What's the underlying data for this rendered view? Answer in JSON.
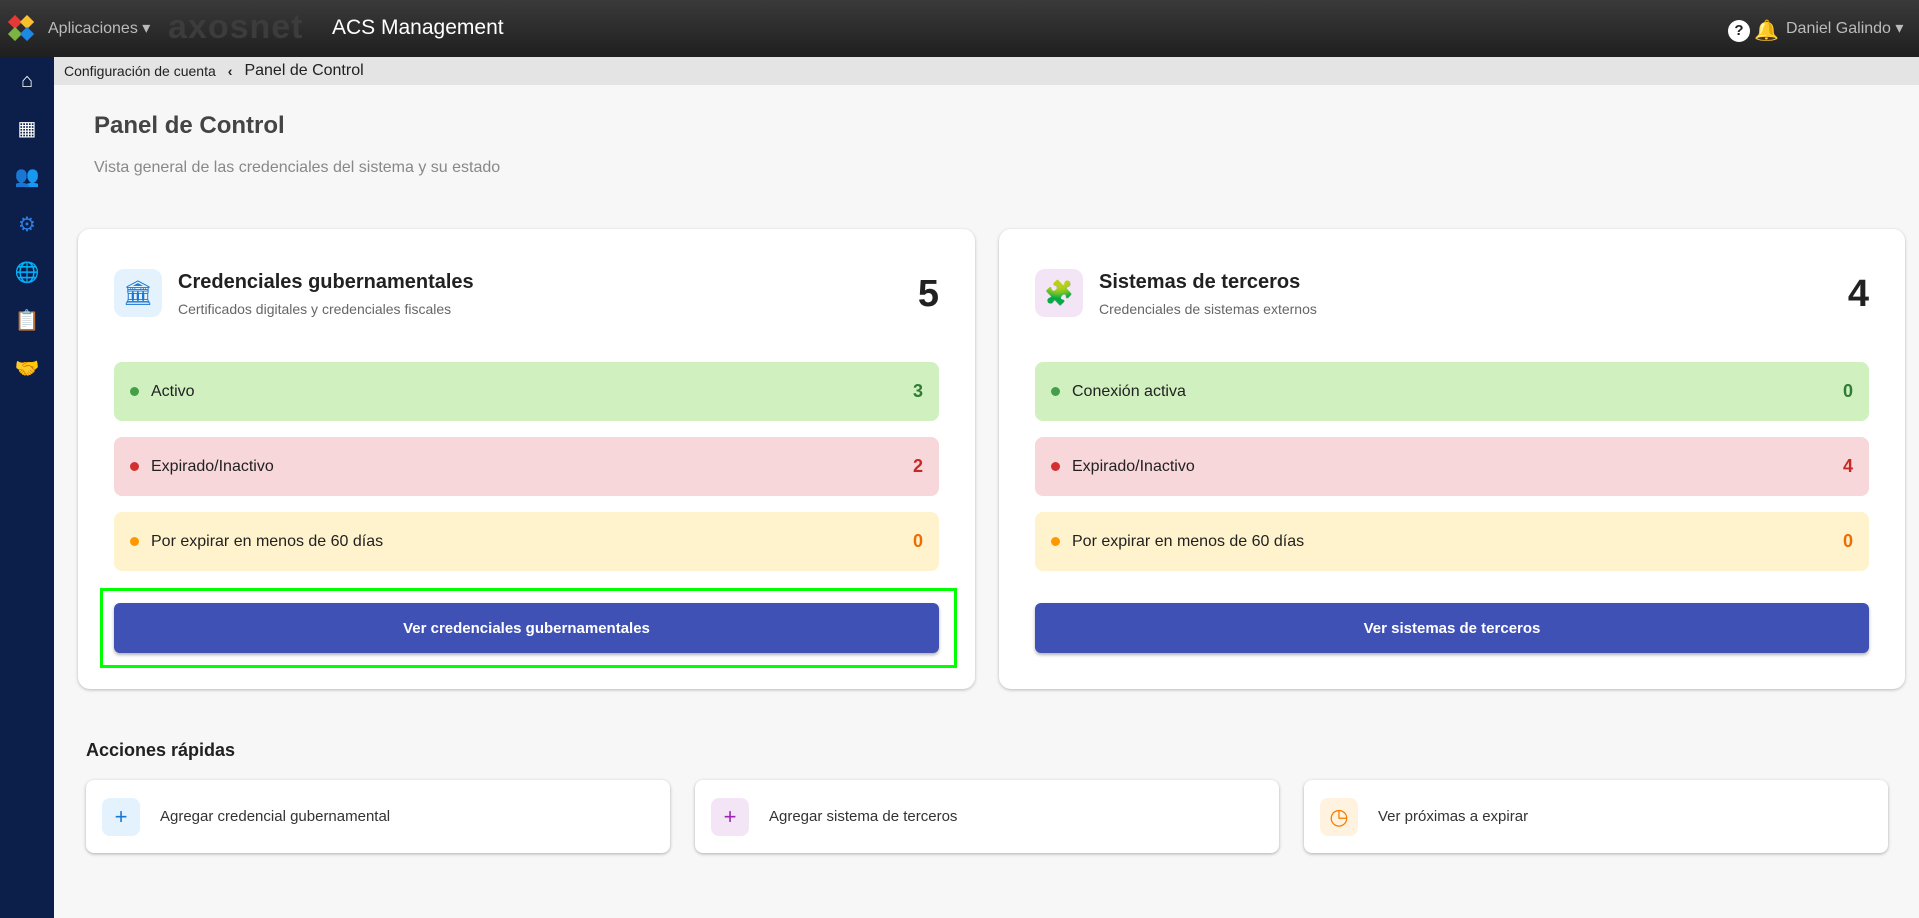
{
  "topbar": {
    "apps_label": "Aplicaciones ▾",
    "brand": "axosnet",
    "title": "ACS Management",
    "help": "?",
    "user": "Daniel Galindo ▾"
  },
  "breadcrumb": {
    "parent": "Configuración de cuenta",
    "separator": "‹",
    "current": "Panel de Control"
  },
  "sidebar": [
    {
      "icon": "home-icon",
      "glyph": "⌂"
    },
    {
      "icon": "building-icon",
      "glyph": "▦"
    },
    {
      "icon": "users-icon",
      "glyph": "👥"
    },
    {
      "icon": "gear-icon",
      "glyph": "⚙"
    },
    {
      "icon": "globe-icon",
      "glyph": "🌐"
    },
    {
      "icon": "clipboard-check-icon",
      "glyph": "📋"
    },
    {
      "icon": "handshake-icon",
      "glyph": "🤝"
    }
  ],
  "page": {
    "title": "Panel de Control",
    "subtitle": "Vista general de las credenciales del sistema y su estado"
  },
  "cards": [
    {
      "title": "Credenciales gubernamentales",
      "subtitle": "Certificados digitales y credenciales fiscales",
      "count": "5",
      "icon": "🏛",
      "rows": [
        {
          "label": "Activo",
          "value": "3"
        },
        {
          "label": "Expirado/Inactivo",
          "value": "2"
        },
        {
          "label": "Por expirar en menos de 60 días",
          "value": "0"
        }
      ],
      "button": "Ver credenciales gubernamentales"
    },
    {
      "title": "Sistemas de terceros",
      "subtitle": "Credenciales de sistemas externos",
      "count": "4",
      "icon": "🧩",
      "rows": [
        {
          "label": "Conexión activa",
          "value": "0"
        },
        {
          "label": "Expirado/Inactivo",
          "value": "4"
        },
        {
          "label": "Por expirar en menos de 60 días",
          "value": "0"
        }
      ],
      "button": "Ver sistemas de terceros"
    }
  ],
  "quick": {
    "title": "Acciones rápidas",
    "items": [
      {
        "label": "Agregar credencial gubernamental",
        "icon": "+"
      },
      {
        "label": "Agregar sistema de terceros",
        "icon": "+"
      },
      {
        "label": "Ver próximas a expirar",
        "icon": "◷"
      }
    ]
  },
  "colors": {
    "primary": "#3f51b5",
    "green": "#d0f0c0",
    "red": "#f8d7da",
    "yellow": "#fff3cd"
  }
}
